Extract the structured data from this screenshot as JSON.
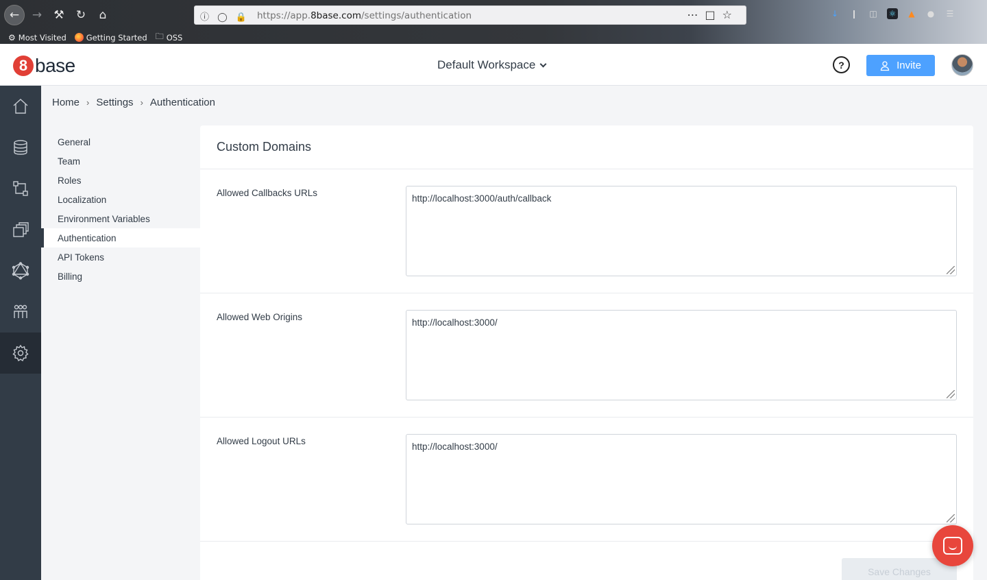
{
  "browser": {
    "url_prefix": "https://app.",
    "url_domain": "8base.com",
    "url_path": "/settings/authentication",
    "bookmarks": [
      {
        "label": "Most Visited"
      },
      {
        "label": "Getting Started"
      },
      {
        "label": "OSS"
      }
    ]
  },
  "header": {
    "logo_mark": "8",
    "logo_text": "base",
    "workspace": "Default Workspace",
    "help_label": "?",
    "invite_label": "Invite"
  },
  "breadcrumb": [
    "Home",
    "Settings",
    "Authentication"
  ],
  "settings_nav": [
    "General",
    "Team",
    "Roles",
    "Localization",
    "Environment Variables",
    "Authentication",
    "API Tokens",
    "Billing"
  ],
  "card": {
    "title": "Custom Domains",
    "rows": [
      {
        "label": "Allowed Callbacks URLs",
        "value": "http://localhost:3000/auth/callback"
      },
      {
        "label": "Allowed Web Origins",
        "value": "http://localhost:3000/"
      },
      {
        "label": "Allowed Logout URLs",
        "value": "http://localhost:3000/"
      }
    ],
    "save_label": "Save Changes"
  },
  "colors": {
    "accent": "#4da1ff",
    "brand": "#e13f36",
    "rail": "#323c47"
  }
}
